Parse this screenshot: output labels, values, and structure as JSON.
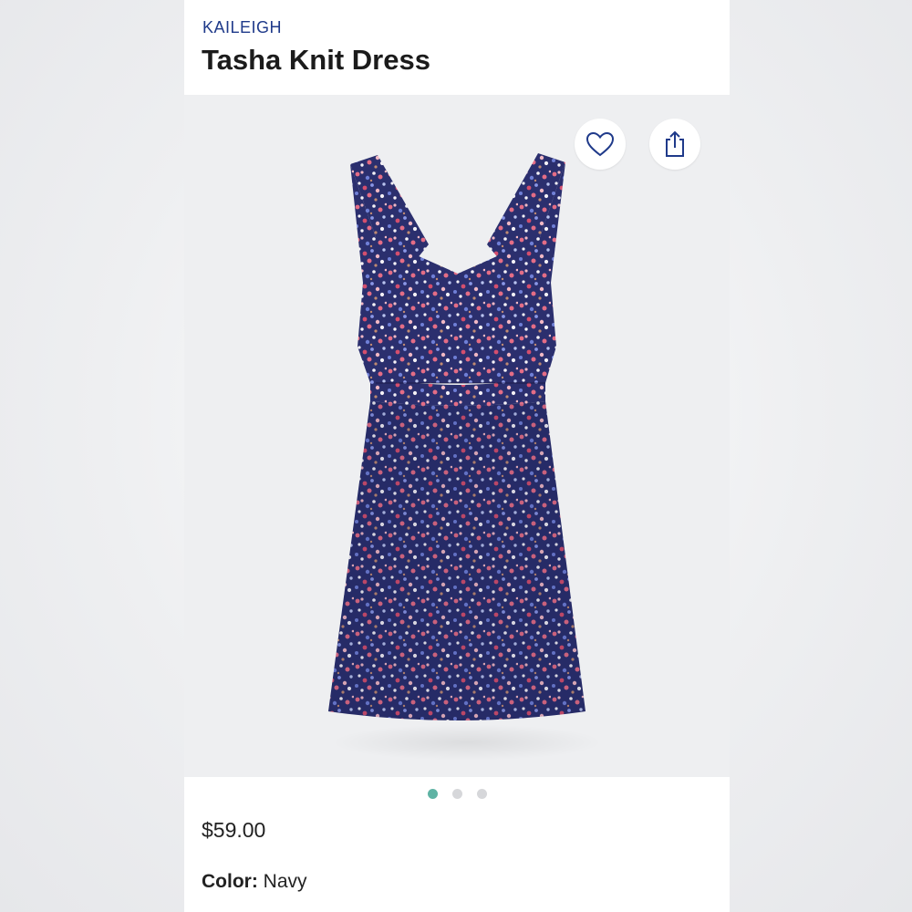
{
  "product": {
    "brand": "KAILEIGH",
    "name": "Tasha Knit Dress",
    "price": "$59.00",
    "color_label": "Color:",
    "color_value": "Navy"
  },
  "gallery": {
    "image_count": 3,
    "active_index": 0,
    "favorite_icon": "heart-outline-icon",
    "share_icon": "share-icon"
  },
  "colors": {
    "brand_text": "#1f3a8a",
    "active_dot": "#5fb3a4",
    "inactive_dot": "#d6d7da",
    "image_bg": "#eeeff1"
  }
}
